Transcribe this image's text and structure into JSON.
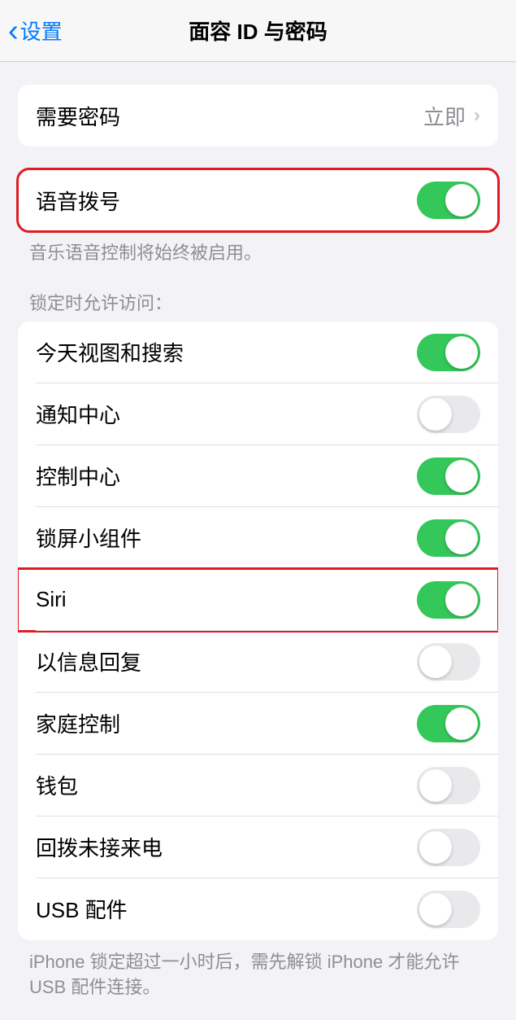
{
  "header": {
    "back": "设置",
    "title": "面容 ID 与密码"
  },
  "require_passcode": {
    "label": "需要密码",
    "value": "立即"
  },
  "voice_dial": {
    "label": "语音拨号",
    "on": true,
    "footer": "音乐语音控制将始终被启用。"
  },
  "locked_access": {
    "header": "锁定时允许访问：",
    "items": [
      {
        "label": "今天视图和搜索",
        "on": true,
        "highlight": false
      },
      {
        "label": "通知中心",
        "on": false,
        "highlight": false
      },
      {
        "label": "控制中心",
        "on": true,
        "highlight": false
      },
      {
        "label": "锁屏小组件",
        "on": true,
        "highlight": false
      },
      {
        "label": "Siri",
        "on": true,
        "highlight": true
      },
      {
        "label": "以信息回复",
        "on": false,
        "highlight": false
      },
      {
        "label": "家庭控制",
        "on": true,
        "highlight": false
      },
      {
        "label": "钱包",
        "on": false,
        "highlight": false
      },
      {
        "label": "回拨未接来电",
        "on": false,
        "highlight": false
      },
      {
        "label": "USB 配件",
        "on": false,
        "highlight": false
      }
    ],
    "footer": "iPhone 锁定超过一小时后，需先解锁 iPhone 才能允许 USB 配件连接。"
  }
}
